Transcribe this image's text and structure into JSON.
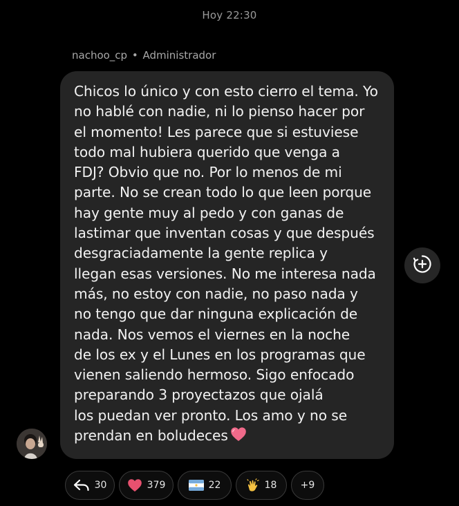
{
  "header": {
    "timestamp": "Hoy 22:30"
  },
  "message": {
    "sender": "nachoo_cp",
    "separator": "•",
    "role": "Administrador",
    "lines": [
      "Chicos lo único y con esto cierro el tema. Yo",
      "no hablé con nadie, ni lo pienso hacer por",
      "el momento! Les parece que si estuviese",
      "todo mal hubiera querido que venga a",
      "FDJ? Obvio que no. Por lo menos de mi",
      "parte. No se crean todo lo que leen porque",
      "hay gente muy al pedo y con ganas de",
      "lastimar que inventan cosas y que después",
      "desgraciadamente la gente replica y",
      "llegan esas versiones. No me interesa nada",
      "más, no estoy con nadie, no paso nada y",
      "no tengo que dar ninguna explicación de",
      "nada. Nos vemos el viernes en la noche",
      "de los ex y el Lunes en los programas que",
      "vienen saliendo hermoso. Sigo enfocado",
      "preparando 3 proyectazos que ojalá",
      "los puedan ver pronto. Los amo y no se",
      "prendan en boludeces"
    ],
    "trailing_emoji": "pink-heart-icon"
  },
  "reactions": {
    "replies": {
      "icon": "reply-arrow-icon",
      "count": "30"
    },
    "hearts": {
      "icon": "heart-icon",
      "count": "379"
    },
    "flag": {
      "icon": "argentina-flag-icon",
      "count": "22"
    },
    "clap": {
      "icon": "clapping-hands-icon",
      "count": "18"
    },
    "more": {
      "label": "+9"
    }
  },
  "colors": {
    "background": "#000000",
    "bubble": "#252525",
    "heart": "#e8516f",
    "flag_blue": "#75aadb",
    "clap": "#f5c242"
  }
}
